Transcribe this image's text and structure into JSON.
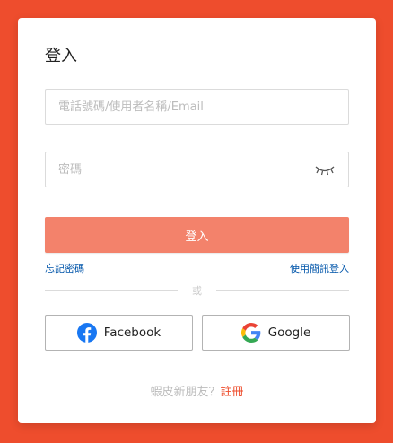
{
  "colors": {
    "background": "#ee4d2d",
    "login_button": "#f3826b",
    "link": "#0055aa",
    "signup_link": "#ee4d2d"
  },
  "login_form": {
    "title": "登入",
    "username_placeholder": "電話號碼/使用者名稱/Email",
    "password_placeholder": "密碼",
    "password_toggle_icon": "eye-closed-icon",
    "login_button": "登入",
    "forgot_password": "忘記密碼",
    "sms_login": "使用簡訊登入",
    "divider_text": "或"
  },
  "social": {
    "facebook": {
      "label": "Facebook",
      "icon": "facebook-icon"
    },
    "google": {
      "label": "Google",
      "icon": "google-icon"
    }
  },
  "signup": {
    "prompt": "蝦皮新朋友？",
    "link": "註冊"
  }
}
